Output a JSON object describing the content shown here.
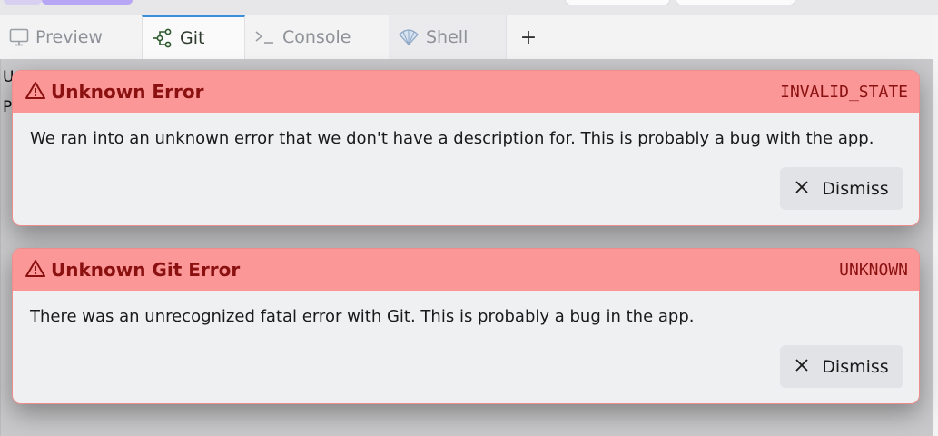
{
  "tabs": [
    {
      "label": "Preview",
      "icon": "monitor-icon"
    },
    {
      "label": "Git",
      "icon": "git-branch-icon"
    },
    {
      "label": "Console",
      "icon": "terminal-icon"
    },
    {
      "label": "Shell",
      "icon": "shell-icon"
    }
  ],
  "add_tab_label": "+",
  "content": {
    "line1": "U",
    "line2": "P"
  },
  "toasts": [
    {
      "title": "Unknown Error",
      "code": "INVALID_STATE",
      "message": "We ran into an unknown error that we don't have a description for. This is probably a bug with the app.",
      "dismiss_label": "Dismiss"
    },
    {
      "title": "Unknown Git Error",
      "code": "UNKNOWN",
      "message": "There was an unrecognized fatal error with Git. This is probably a bug in the app.",
      "dismiss_label": "Dismiss"
    }
  ],
  "colors": {
    "toast_header": "#fb9797",
    "toast_title": "#8b1111",
    "active_tab_accent": "#3b8fd8"
  }
}
